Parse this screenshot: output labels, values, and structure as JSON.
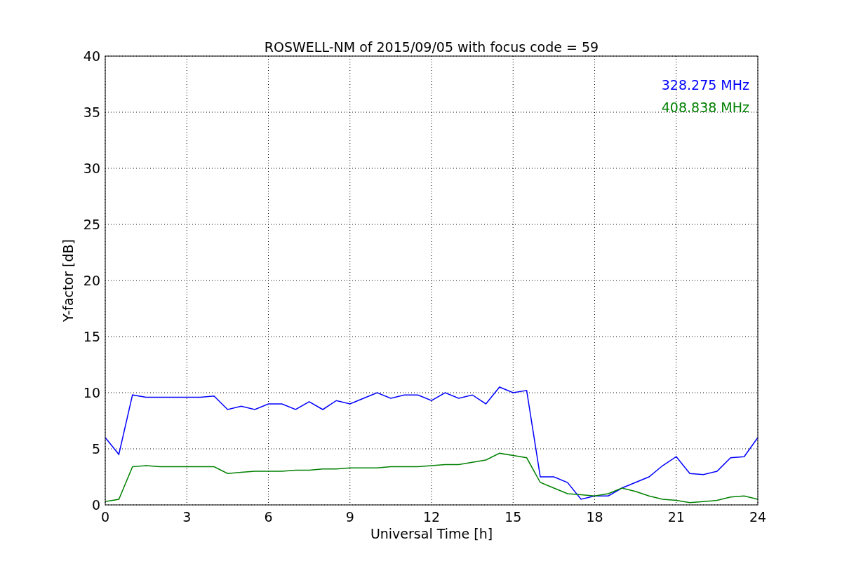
{
  "figure": {
    "chart_data": {
      "type": "line",
      "title": "ROSWELL-NM of 2015/09/05 with focus code = 59",
      "xlabel": "Universal Time [h]",
      "ylabel": "Y-factor [dB]",
      "x": [
        0,
        0.5,
        1,
        1.5,
        2,
        2.5,
        3,
        3.5,
        4,
        4.5,
        5,
        5.5,
        6,
        6.5,
        7,
        7.5,
        8,
        8.5,
        9,
        9.5,
        10,
        10.5,
        11,
        11.5,
        12,
        12.5,
        13,
        13.5,
        14,
        14.5,
        15,
        15.5,
        16,
        16.5,
        17,
        17.5,
        18,
        18.5,
        19,
        19.5,
        20,
        20.5,
        21,
        21.5,
        22,
        22.5,
        23,
        23.5,
        24
      ],
      "series": [
        {
          "name": "328.275 MHz",
          "color": "#0000ff",
          "values": [
            6,
            4.5,
            9.8,
            9.6,
            9.6,
            9.6,
            9.6,
            9.6,
            9.7,
            8.5,
            8.8,
            8.5,
            9.0,
            9.0,
            8.5,
            9.2,
            8.5,
            9.3,
            9.0,
            9.5,
            10.0,
            9.5,
            9.8,
            9.8,
            9.3,
            10.0,
            9.5,
            9.8,
            9.0,
            10.5,
            10.0,
            10.2,
            2.5,
            2.5,
            2.0,
            0.5,
            0.8,
            0.8,
            1.5,
            2.0,
            2.5,
            3.5,
            4.3,
            2.8,
            2.7,
            3.0,
            4.2,
            4.3,
            6.0
          ]
        },
        {
          "name": "408.838 MHz",
          "color": "#008000",
          "values": [
            0.3,
            0.5,
            3.4,
            3.5,
            3.4,
            3.4,
            3.4,
            3.4,
            3.4,
            2.8,
            2.9,
            3.0,
            3.0,
            3.0,
            3.1,
            3.1,
            3.2,
            3.2,
            3.3,
            3.3,
            3.3,
            3.4,
            3.4,
            3.4,
            3.5,
            3.6,
            3.6,
            3.8,
            4.0,
            4.6,
            4.4,
            4.2,
            2.0,
            1.5,
            1.0,
            0.9,
            0.8,
            1.0,
            1.5,
            1.2,
            0.8,
            0.5,
            0.4,
            0.2,
            0.3,
            0.4,
            0.7,
            0.8,
            0.5
          ]
        }
      ],
      "xlim": [
        0,
        24
      ],
      "ylim": [
        0,
        40
      ],
      "xticks": [
        0,
        3,
        6,
        9,
        12,
        15,
        18,
        21,
        24
      ],
      "yticks": [
        0,
        5,
        10,
        15,
        20,
        25,
        30,
        35,
        40
      ],
      "grid": true
    }
  }
}
